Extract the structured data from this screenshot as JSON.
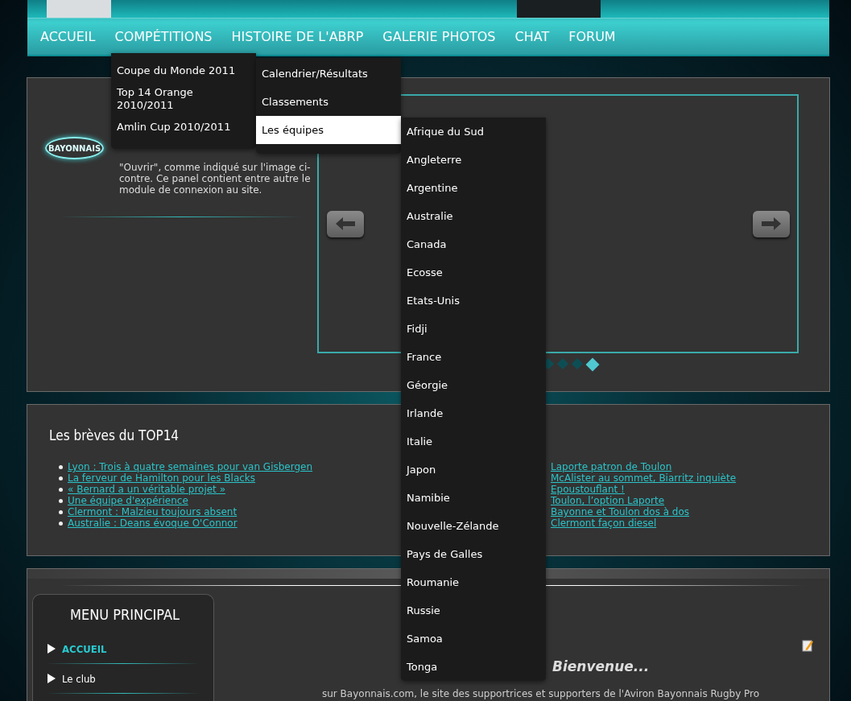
{
  "nav": {
    "items": [
      {
        "label": "ACCUEIL"
      },
      {
        "label": "COMPÉTITIONS"
      },
      {
        "label": "HISTOIRE DE L'ABRP"
      },
      {
        "label": "GALERIE PHOTOS"
      },
      {
        "label": "CHAT"
      },
      {
        "label": "FORUM"
      }
    ]
  },
  "competitions_menu": {
    "items": [
      {
        "label": "Coupe du Monde 2011"
      },
      {
        "label": "Top 14 Orange 2010/2011"
      },
      {
        "label": "Amlin Cup 2010/2011"
      }
    ]
  },
  "world_cup_menu": {
    "items": [
      {
        "label": "Calendrier/Résultats",
        "selected": false
      },
      {
        "label": "Classements",
        "selected": false
      },
      {
        "label": "Les équipes",
        "selected": true
      }
    ]
  },
  "teams_menu": {
    "items": [
      "Afrique du Sud",
      "Angleterre",
      "Argentine",
      "Australie",
      "Canada",
      "Ecosse",
      "Etats-Unis",
      "Fidji",
      "France",
      "Géorgie",
      "Irlande",
      "Italie",
      "Japon",
      "Namibie",
      "Nouvelle-Zélande",
      "Pays de Galles",
      "Roumanie",
      "Russie",
      "Samoa",
      "Tonga"
    ]
  },
  "intro": {
    "logo_text": "BAYONNAIS",
    "text": "\"Ouvrir\", comme indiqué sur l'image ci-contre. Ce panel contient entre autre le module de connexion au site."
  },
  "slider": {
    "dots": [
      {
        "selected": false
      },
      {
        "selected": false
      },
      {
        "selected": false
      },
      {
        "selected": true
      }
    ]
  },
  "breves": {
    "title": "Les brèves du TOP14",
    "links": [
      "Lyon : Trois à quatre semaines pour van Gisbergen",
      "La ferveur de Hamilton pour les Blacks",
      "« Bernard a un véritable projet »",
      "Une équipe d'expérience",
      "Clermont : Malzieu toujours absent",
      "Australie : Deans évoque O'Connor"
    ]
  },
  "actualites": {
    "links": [
      "Laporte patron de Toulon",
      "McAlister au sommet, Biarritz inquiète",
      "Epoustouflant !",
      "Toulon, l’option Laporte",
      "Bayonne et Toulon dos à dos",
      "Clermont façon diesel"
    ]
  },
  "main_menu": {
    "title": "MENU PRINCIPAL",
    "items": [
      {
        "label": "ACCUEIL",
        "selected": true
      },
      {
        "label": "Le club",
        "selected": false
      }
    ]
  },
  "content": {
    "heading": "Bienvenue...",
    "text": "sur Bayonnais.com, le site des supportrices et supporters de l'Aviron Bayonnais Rugby Pro"
  }
}
